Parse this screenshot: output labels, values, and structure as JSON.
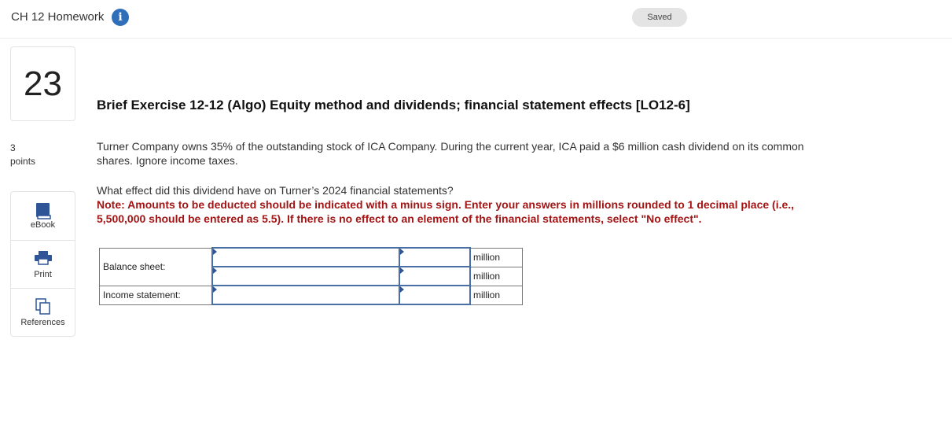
{
  "header": {
    "title": "CH 12 Homework",
    "info_icon": "i",
    "status": "Saved"
  },
  "question": {
    "number": "23",
    "points_value": "3",
    "points_label": "points",
    "heading": "Brief Exercise 12-12 (Algo) Equity method and dividends; financial statement effects [LO12-6]",
    "paragraph1": "Turner Company owns 35% of the outstanding stock of ICA Company. During the current year, ICA paid a $6 million cash dividend on its common shares. Ignore income taxes.",
    "paragraph2": "What effect did this dividend have on Turner’s 2024 financial statements?",
    "note": "Note: Amounts to be deducted should be indicated with a minus sign. Enter your answers in millions rounded to 1 decimal place (i.e., 5,500,000 should be entered as 5.5). If there is no effect to an element of the financial statements, select \"No effect\"."
  },
  "tools": [
    {
      "label": "eBook",
      "icon": "book-icon"
    },
    {
      "label": "Print",
      "icon": "printer-icon"
    },
    {
      "label": "References",
      "icon": "copy-icon"
    }
  ],
  "answer_table": {
    "rows": [
      {
        "label": "Balance sheet:",
        "select_value": "",
        "amount_value": "",
        "unit": "million"
      },
      {
        "label": "",
        "select_value": "",
        "amount_value": "",
        "unit": "million"
      },
      {
        "label": "Income statement:",
        "select_value": "",
        "amount_value": "",
        "unit": "million"
      }
    ]
  },
  "colors": {
    "accent": "#2f6fba",
    "note_red": "#a31515",
    "field_border": "#4a6fa5"
  }
}
